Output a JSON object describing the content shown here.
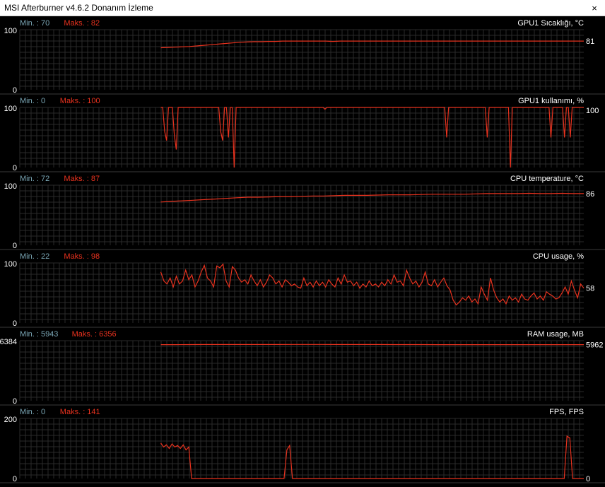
{
  "window": {
    "title": "MSI Afterburner v4.6.2 Donanım İzleme",
    "close_glyph": "×",
    "close_icon": "close-icon"
  },
  "colors": {
    "background": "#000000",
    "grid": "#2a2a2a",
    "line": "#e8321e",
    "min_label": "#7aa6b5",
    "max_label": "#e8321e",
    "text": "#ffffff"
  },
  "chart_data": [
    {
      "type": "line",
      "title": "GPU1 Sıcaklığı, °C",
      "min_label": "Min. : 70",
      "max_label": "Maks. : 82",
      "ylim": [
        0,
        100
      ],
      "y_top_label": "100",
      "y_bottom_label": "0",
      "current_value": "81",
      "start_index": 0.25,
      "series": [
        {
          "values": [
            70,
            70.5,
            71,
            71.5,
            72,
            73,
            74,
            75,
            76,
            77,
            78,
            79,
            79.5,
            80,
            80,
            80.5,
            80.5,
            81,
            81,
            81,
            81,
            81,
            81,
            81,
            80.5,
            81,
            81,
            81,
            81,
            81,
            81,
            81,
            81,
            81,
            81,
            81,
            81,
            81,
            81,
            81,
            81,
            81,
            81,
            81,
            81,
            81,
            81,
            81,
            81,
            81,
            81,
            81,
            81,
            81,
            81,
            81,
            81,
            81,
            81,
            81
          ]
        }
      ]
    },
    {
      "type": "line",
      "title": "GPU1 kullanımı, %",
      "min_label": "Min. : 0",
      "max_label": "Maks. : 100",
      "ylim": [
        0,
        100
      ],
      "y_top_label": "100",
      "y_bottom_label": "0",
      "current_value": "100",
      "start_index": 0.25,
      "series": [
        {
          "values": [
            100,
            100,
            60,
            45,
            100,
            100,
            100,
            55,
            30,
            100,
            100,
            100,
            100,
            100,
            100,
            100,
            100,
            100,
            100,
            100,
            100,
            100,
            100,
            100,
            100,
            100,
            100,
            100,
            100,
            100,
            100,
            60,
            45,
            100,
            100,
            50,
            100,
            100,
            0,
            100,
            100,
            100,
            100,
            100,
            100,
            100,
            100,
            100,
            100,
            100,
            100,
            100,
            100,
            100,
            100,
            100,
            100,
            100,
            100,
            100,
            100,
            100,
            100,
            100,
            100,
            100,
            100,
            100,
            100,
            100,
            100,
            100,
            100,
            100,
            100,
            100,
            100,
            100,
            100,
            100,
            100,
            100,
            100,
            100,
            100,
            97,
            100,
            100,
            100,
            100,
            100,
            100,
            100,
            100,
            100,
            100,
            100,
            100,
            100,
            100,
            100,
            100,
            100,
            100,
            100,
            100,
            100,
            100,
            100,
            100,
            100,
            100,
            100,
            100,
            100,
            100,
            100,
            100,
            100,
            100,
            100,
            100,
            100,
            100,
            100,
            100,
            100,
            100,
            100,
            100,
            100,
            100,
            100,
            100,
            100,
            100,
            100,
            100,
            100,
            100,
            100,
            100,
            100,
            100,
            100,
            100,
            100,
            100,
            50,
            100,
            100,
            100,
            100,
            100,
            100,
            100,
            100,
            100,
            100,
            100,
            100,
            100,
            100,
            100,
            100,
            100,
            100,
            100,
            100,
            50,
            100,
            100,
            100,
            100,
            100,
            100,
            100,
            100,
            100,
            100,
            100,
            0,
            100,
            100,
            100,
            100,
            100,
            100,
            100,
            100,
            100,
            100,
            100,
            100,
            100,
            100,
            100,
            100,
            100,
            100,
            100,
            100,
            50,
            100,
            100,
            100,
            100,
            100,
            100,
            50,
            100,
            100,
            50,
            100,
            100,
            100,
            100,
            100,
            100,
            100
          ]
        }
      ]
    },
    {
      "type": "line",
      "title": "CPU temperature, °C",
      "min_label": "Min. : 72",
      "max_label": "Maks. : 87",
      "ylim": [
        0,
        100
      ],
      "y_top_label": "100",
      "y_bottom_label": "0",
      "current_value": "86",
      "start_index": 0.25,
      "series": [
        {
          "values": [
            72,
            73,
            74,
            75,
            76,
            77,
            78,
            79,
            80,
            80,
            80.5,
            81,
            81,
            81.5,
            82,
            82,
            82.5,
            83,
            83,
            83,
            83.5,
            84,
            84,
            84,
            84.5,
            85,
            85,
            85,
            85,
            85.5,
            86,
            86,
            86,
            86,
            86.5,
            86,
            86,
            86.5,
            86,
            86
          ]
        }
      ]
    },
    {
      "type": "line",
      "title": "CPU usage, %",
      "min_label": "Min. : 22",
      "max_label": "Maks. : 98",
      "ylim": [
        0,
        100
      ],
      "y_top_label": "100",
      "y_bottom_label": "0",
      "current_value": "58",
      "start_index": 0.25,
      "series": [
        {
          "values": [
            85,
            70,
            65,
            75,
            60,
            78,
            65,
            70,
            88,
            72,
            80,
            60,
            70,
            85,
            96,
            75,
            70,
            60,
            95,
            92,
            98,
            70,
            60,
            94,
            88,
            75,
            68,
            72,
            65,
            80,
            70,
            62,
            72,
            60,
            68,
            80,
            75,
            65,
            70,
            60,
            72,
            68,
            62,
            65,
            60,
            58,
            75,
            62,
            68,
            60,
            70,
            62,
            68,
            60,
            72,
            65,
            60,
            75,
            65,
            80,
            68,
            70,
            62,
            68,
            58,
            65,
            60,
            70,
            62,
            65,
            60,
            68,
            62,
            72,
            65,
            80,
            68,
            70,
            62,
            88,
            75,
            65,
            70,
            60,
            68,
            85,
            65,
            62,
            72,
            60,
            68,
            75,
            62,
            55,
            38,
            30,
            35,
            42,
            38,
            45,
            35,
            40,
            32,
            60,
            48,
            38,
            75,
            55,
            42,
            35,
            40,
            32,
            45,
            38,
            42,
            35,
            48,
            40,
            38,
            45,
            50,
            40,
            45,
            38,
            52,
            48,
            45,
            40,
            42,
            50,
            60,
            48,
            70,
            55,
            42,
            65,
            58
          ]
        }
      ]
    },
    {
      "type": "line",
      "title": "RAM usage, MB",
      "min_label": "Min. : 5943",
      "max_label": "Maks. : 6356",
      "ylim": [
        0,
        6384
      ],
      "y_top_label": "6384",
      "y_bottom_label": "0",
      "current_value": "5962",
      "start_index": 0.25,
      "series": [
        {
          "values": [
            5960,
            5965,
            5970,
            5975,
            5975,
            5980,
            5978,
            5980,
            5982,
            5985,
            5985,
            5983,
            5982,
            5980,
            5978,
            5975,
            5972,
            5970,
            5968,
            5966,
            5965,
            5964,
            5963,
            5962,
            5962,
            5961,
            5962,
            5960,
            5962,
            5962
          ]
        }
      ]
    },
    {
      "type": "line",
      "title": "FPS, FPS",
      "min_label": "Min. : 0",
      "max_label": "Maks. : 141",
      "ylim": [
        0,
        200
      ],
      "y_top_label": "200",
      "y_bottom_label": "0",
      "current_value": "0",
      "start_index": 0.25,
      "series": [
        {
          "values": [
            118,
            105,
            112,
            100,
            115,
            105,
            110,
            100,
            112,
            95,
            105,
            0,
            0,
            0,
            0,
            0,
            0,
            0,
            0,
            0,
            0,
            0,
            0,
            0,
            0,
            0,
            0,
            0,
            0,
            0,
            0,
            0,
            0,
            0,
            0,
            0,
            0,
            0,
            0,
            0,
            0,
            0,
            0,
            0,
            0,
            95,
            110,
            0,
            0,
            0,
            0,
            0,
            0,
            0,
            0,
            0,
            0,
            0,
            0,
            0,
            0,
            0,
            0,
            0,
            0,
            0,
            0,
            0,
            0,
            0,
            0,
            0,
            0,
            0,
            0,
            0,
            0,
            0,
            0,
            0,
            0,
            0,
            0,
            0,
            0,
            0,
            0,
            0,
            0,
            0,
            0,
            0,
            0,
            0,
            0,
            0,
            0,
            0,
            0,
            0,
            0,
            0,
            0,
            0,
            0,
            0,
            0,
            0,
            0,
            0,
            0,
            0,
            0,
            0,
            0,
            0,
            0,
            0,
            0,
            0,
            0,
            0,
            0,
            0,
            0,
            0,
            0,
            0,
            0,
            0,
            0,
            0,
            0,
            0,
            0,
            0,
            0,
            0,
            0,
            0,
            0,
            0,
            0,
            0,
            0,
            141,
            135,
            0,
            0,
            0,
            0,
            0
          ]
        }
      ]
    }
  ]
}
